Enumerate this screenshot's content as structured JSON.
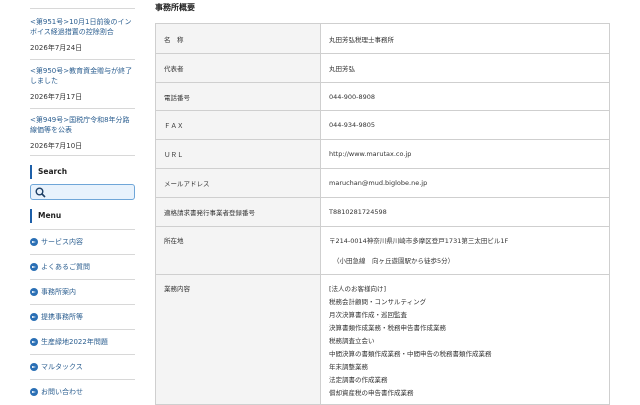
{
  "sidebar": {
    "news": [
      {
        "title": "<第951号>10月1日前後のインボイス経過措置の控除割合",
        "date": "2026年7月24日"
      },
      {
        "title": "<第950号>教育資金贈与が終了しました",
        "date": "2026年7月17日"
      },
      {
        "title": "<第949号>国税庁令和8年分路線価等を公表",
        "date": "2026年7月10日"
      }
    ],
    "search_heading": "Search",
    "menu_heading": "Menu",
    "menu_items": [
      "サービス内容",
      "よくあるご質問",
      "事務所案内",
      "提携事務所等",
      "生産緑地2022年問題",
      "マルタックス",
      "お問い合わせ"
    ]
  },
  "main": {
    "title": "事務所概要",
    "rows": [
      {
        "label": "名　称",
        "value": "丸田芳弘税理士事務所"
      },
      {
        "label": "代表者",
        "value": "丸田芳弘"
      },
      {
        "label": "電話番号",
        "value": "044-900-8908"
      },
      {
        "label": "ＦＡＸ",
        "value": "044-934-9805"
      },
      {
        "label": "ＵＲＬ",
        "value": "http://www.marutax.co.jp"
      },
      {
        "label": "メールアドレス",
        "value": "maruchan@mud.biglobe.ne.jp"
      },
      {
        "label": "適格請求書発行事業者登録番号",
        "value": "T8810281724598"
      }
    ],
    "address": {
      "label": "所在地",
      "line1": "〒214-0014神奈川県川崎市多摩区登戸1731第三太田ビル1F",
      "line2": "（小田急線　向ヶ丘遊園駅から徒歩5分）"
    },
    "business": {
      "label": "業務内容",
      "lines": [
        "[法人のお客様向け]",
        "税務会計顧問・コンサルティング",
        "月次決算書作成・巡回監査",
        "決算書類作成業務・税務申告書作成業務",
        "税務調査立会い",
        "中間決算の書類作成業務・中間申告の税務書類作成業務",
        "年末調整業務",
        "法定調書の作成業務",
        "償却資産税の申告書作成業務"
      ]
    }
  }
}
